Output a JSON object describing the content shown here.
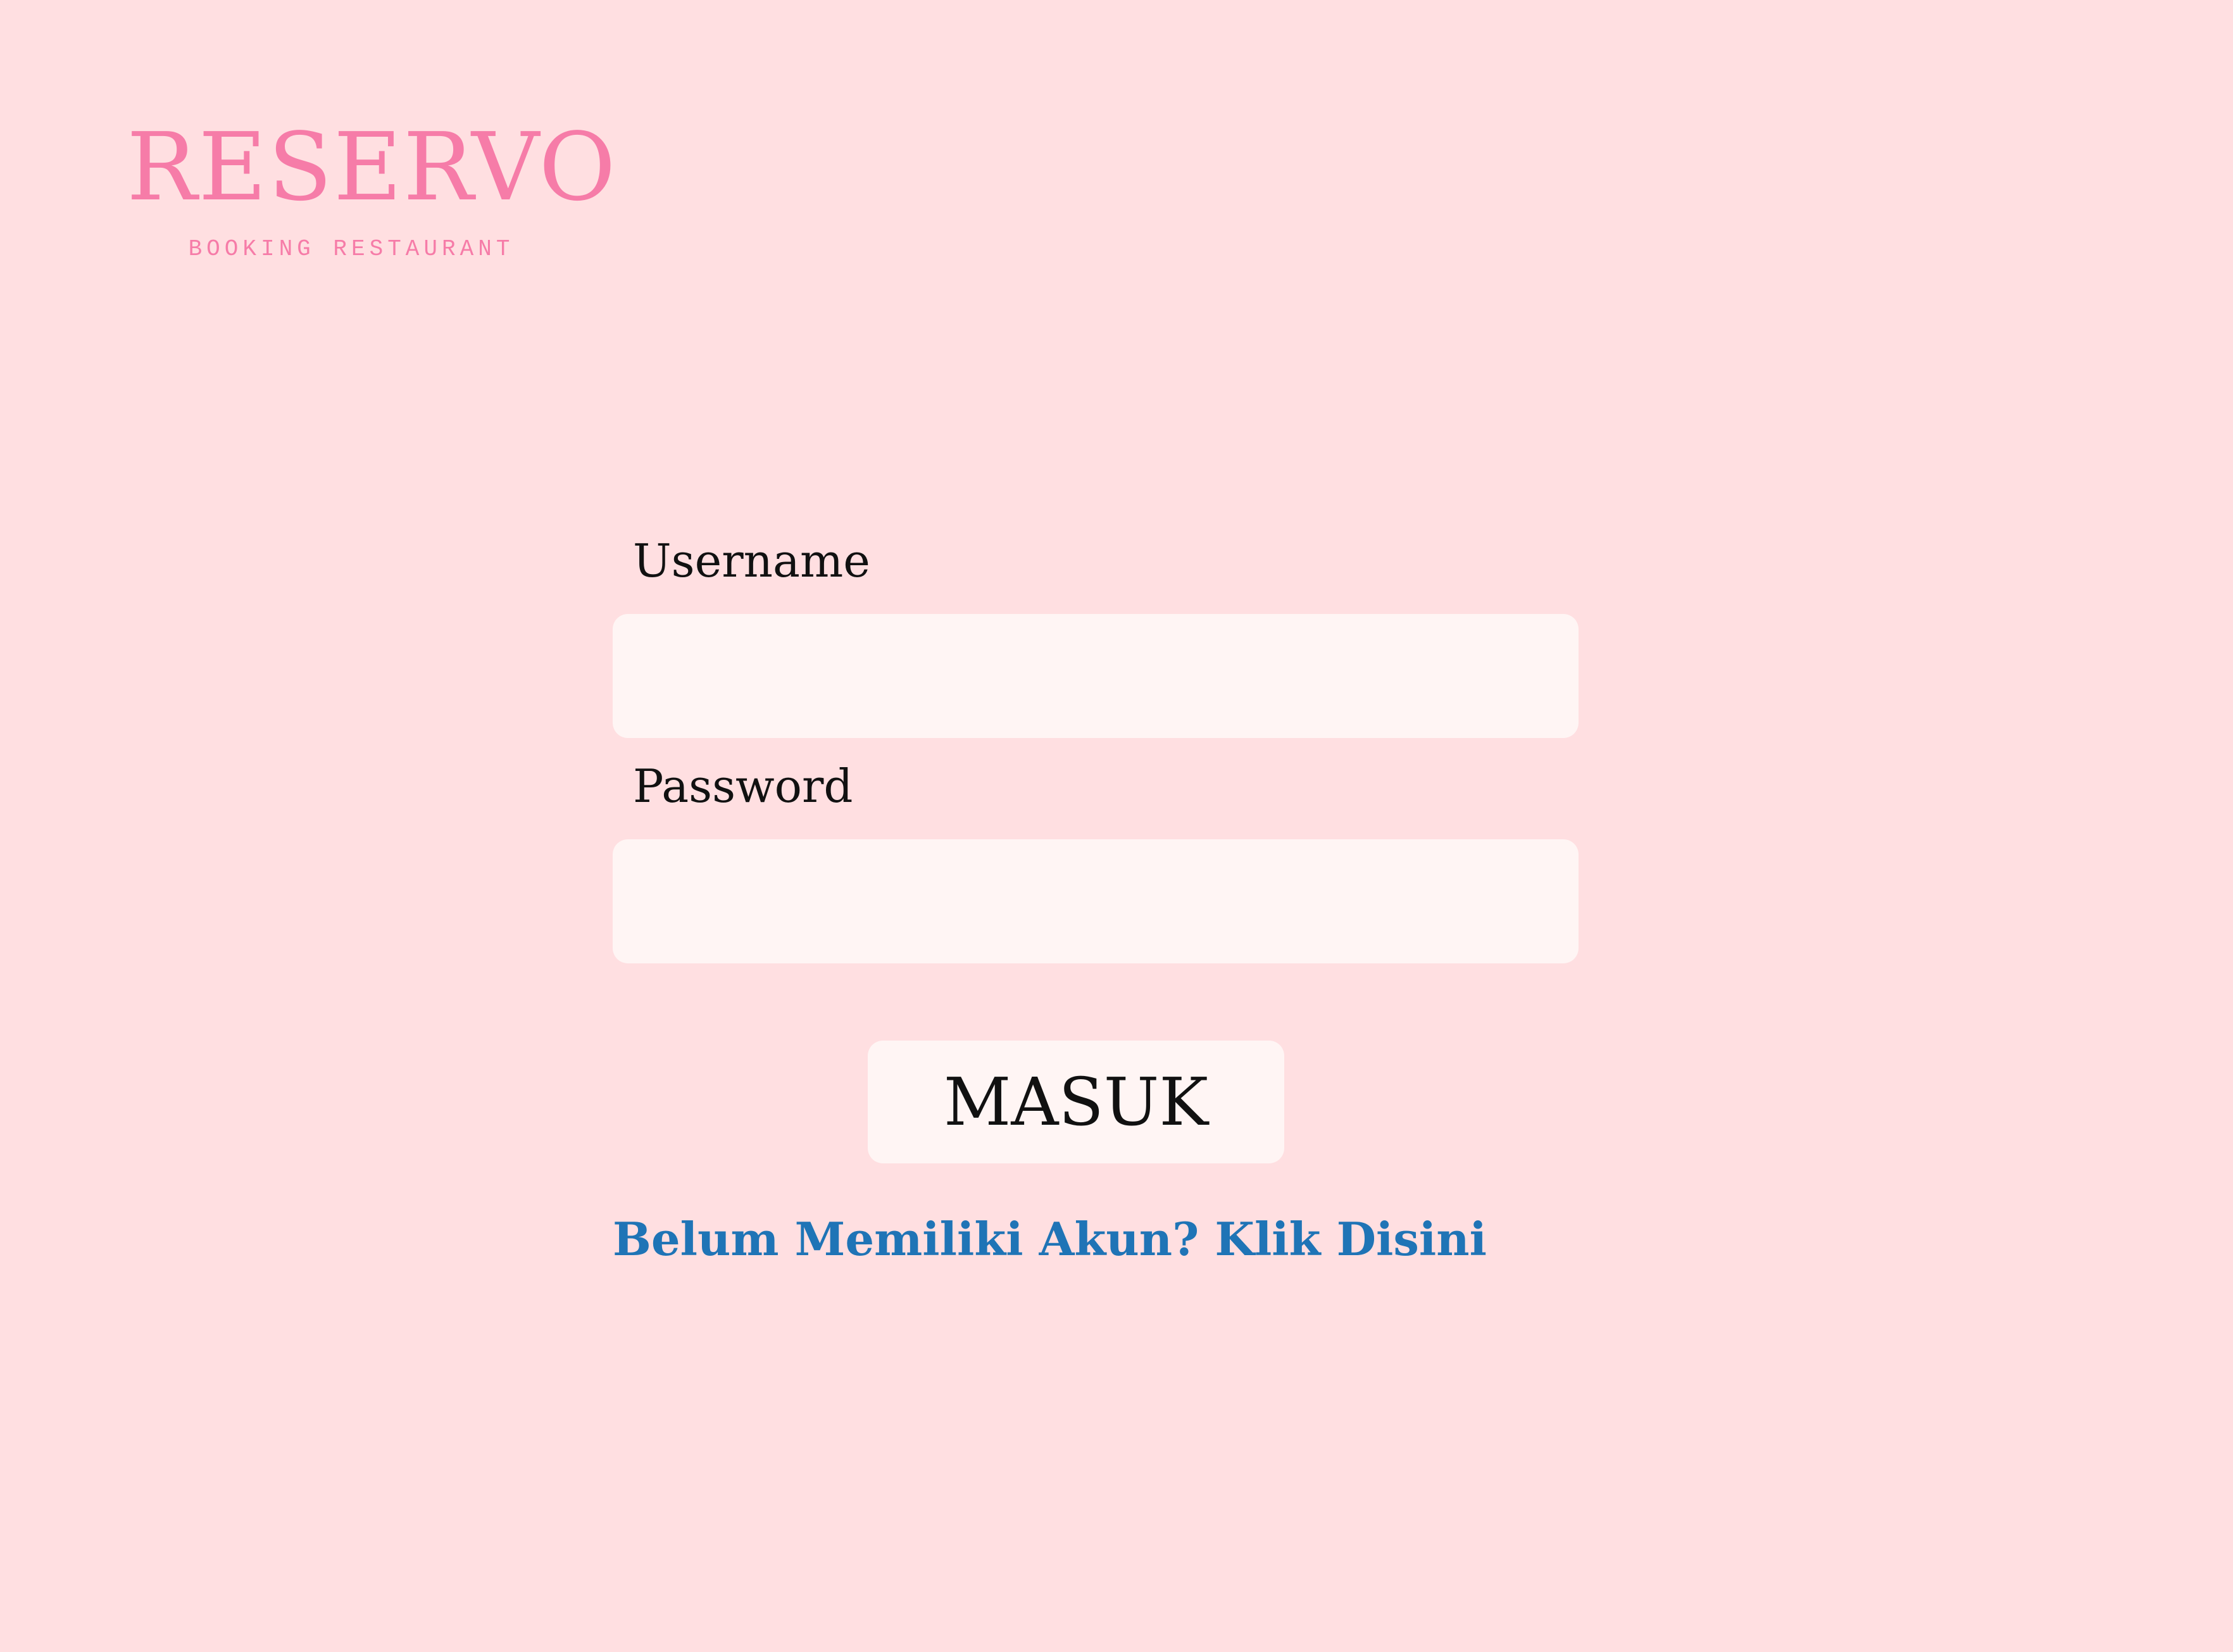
{
  "brand": {
    "title": "RESERVO",
    "subtitle": "BOOKING RESTAURANT"
  },
  "form": {
    "username_label": "Username",
    "username_value": "",
    "password_label": "Password",
    "password_value": "",
    "submit_label": "MASUK",
    "register_link": "Belum Memiliki Akun? Klik Disini"
  },
  "colors": {
    "background": "#ffdfe1",
    "brand": "#f67ca8",
    "input_background": "#fff5f4",
    "link": "#1f74b6",
    "text": "#111111"
  }
}
